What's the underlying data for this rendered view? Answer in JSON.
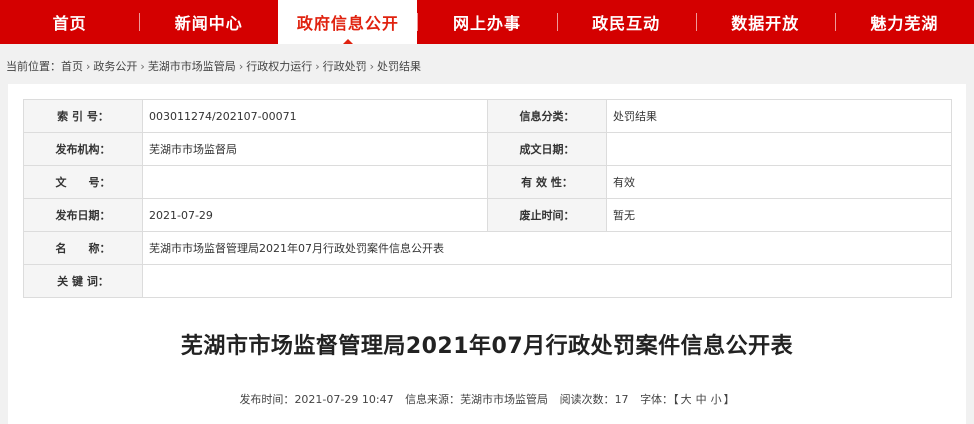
{
  "nav": {
    "items": [
      {
        "label": "首页"
      },
      {
        "label": "新闻中心"
      },
      {
        "label": "政府信息公开",
        "active": true
      },
      {
        "label": "网上办事"
      },
      {
        "label": "政民互动"
      },
      {
        "label": "数据开放"
      },
      {
        "label": "魅力芜湖"
      }
    ]
  },
  "breadcrumb": {
    "prefix": "当前位置：",
    "separator": "›",
    "items": [
      "首页",
      "政务公开",
      "芜湖市市场监管局",
      "行政权力运行",
      "行政处罚",
      "处罚结果"
    ]
  },
  "meta": {
    "index_label": "索 引 号：",
    "index_value": "003011274/202107-00071",
    "category_label": "信息分类：",
    "category_value": "处罚结果",
    "publisher_label": "发布机构：",
    "publisher_value": "芜湖市市场监督局",
    "created_label": "成文日期：",
    "created_value": "",
    "docno_label": "文　　号：",
    "docno_value": "",
    "validity_label": "有 效 性：",
    "validity_value": "有效",
    "pubdate_label": "发布日期：",
    "pubdate_value": "2021-07-29",
    "expire_label": "废止时间：",
    "expire_value": "暂无",
    "name_label": "名　　称：",
    "name_value": "芜湖市市场监督管理局2021年07月行政处罚案件信息公开表",
    "keywords_label": "关 键 词：",
    "keywords_value": ""
  },
  "doc": {
    "title": "芜湖市市场监督管理局2021年07月行政处罚案件信息公开表"
  },
  "info": {
    "time_label": "发布时间：",
    "time_value": "2021-07-29 10:47",
    "source_label": "信息来源：",
    "source_value": "芜湖市市场监管局",
    "views_label": "阅读次数：",
    "views_value": "17",
    "font_label": "字体：",
    "font_open": "【",
    "font_large": "大",
    "font_medium": "中",
    "font_small": "小",
    "font_close": "】"
  }
}
